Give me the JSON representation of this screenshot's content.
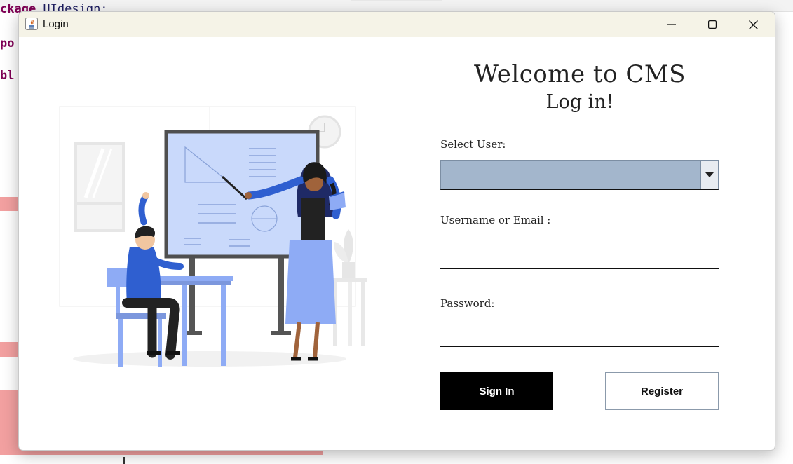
{
  "ide": {
    "lines": [
      {
        "prefix": "ckage",
        "rest": " UIdesign;"
      },
      {
        "prefix": "po",
        "rest": ""
      },
      {
        "prefix": "bl",
        "rest": ""
      }
    ]
  },
  "window": {
    "title": "Login",
    "controls": {
      "minimize_icon": "minimize-icon",
      "maximize_icon": "maximize-icon",
      "close_icon": "close-icon"
    }
  },
  "form": {
    "welcome": "Welcome to CMS",
    "subtitle": "Log in!",
    "select_user_label": "Select User:",
    "select_user_value": "",
    "username_label": "Username or Email :",
    "username_value": "",
    "password_label": "Password:",
    "password_value": "",
    "sign_in_label": "Sign In",
    "register_label": "Register"
  },
  "colors": {
    "select_bg": "#a3b6cc",
    "sign_in_bg": "#000000",
    "accent_blue": "#8eabf5",
    "dark_blue": "#2f5fd0"
  }
}
